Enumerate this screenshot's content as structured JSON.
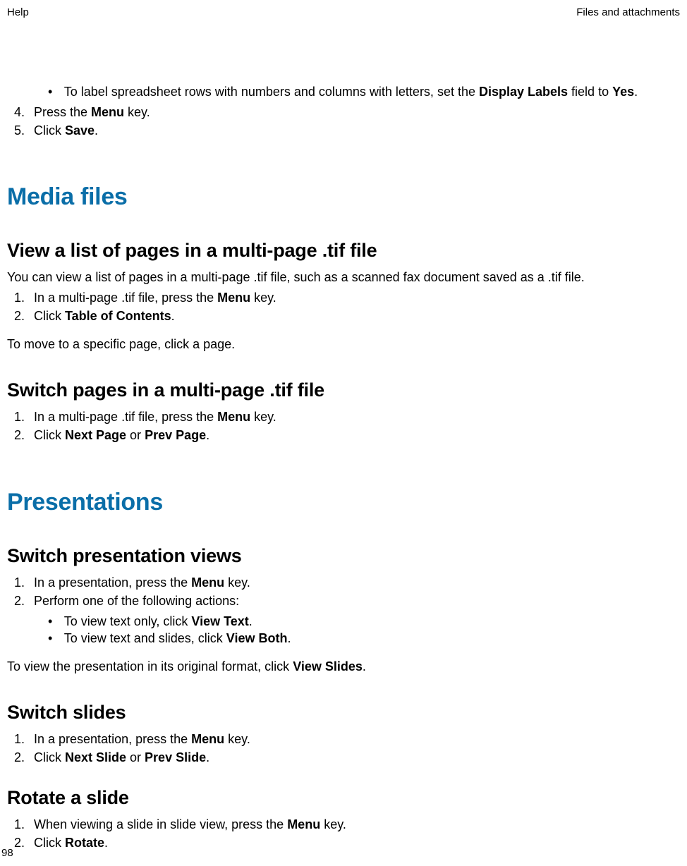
{
  "header": {
    "left": "Help",
    "right": "Files and attachments"
  },
  "top": {
    "bullet": {
      "pre": "To label spreadsheet rows with numbers and columns with letters, set the ",
      "b1": "Display Labels",
      "mid": " field to ",
      "b2": "Yes",
      "post": "."
    },
    "step4": {
      "num": "4.",
      "pre": "Press the ",
      "b": "Menu",
      "post": " key."
    },
    "step5": {
      "num": "5.",
      "pre": "Click ",
      "b": "Save",
      "post": "."
    }
  },
  "media": {
    "heading": "Media files",
    "viewList": {
      "heading": "View a list of pages in a multi-page .tif file",
      "intro": "You can view a list of pages in a multi-page .tif file, such as a scanned fax document saved as a .tif file.",
      "step1": {
        "num": "1.",
        "pre": "In a multi-page .tif file, press the ",
        "b": "Menu",
        "post": " key."
      },
      "step2": {
        "num": "2.",
        "pre": "Click ",
        "b": "Table of Contents",
        "post": "."
      },
      "follow": "To move to a specific page, click a page."
    },
    "switchPages": {
      "heading": "Switch pages in a multi-page .tif file",
      "step1": {
        "num": "1.",
        "pre": "In a multi-page .tif file, press the ",
        "b": "Menu",
        "post": " key."
      },
      "step2": {
        "num": "2.",
        "pre": "Click ",
        "b1": "Next Page",
        "mid": " or ",
        "b2": "Prev Page",
        "post": "."
      }
    }
  },
  "presentations": {
    "heading": "Presentations",
    "switchViews": {
      "heading": "Switch presentation views",
      "step1": {
        "num": "1.",
        "pre": "In a presentation, press the ",
        "b": "Menu",
        "post": " key."
      },
      "step2": {
        "num": "2.",
        "text": "Perform one of the following actions:"
      },
      "sub1": {
        "pre": "To view text only, click ",
        "b": "View Text",
        "post": "."
      },
      "sub2": {
        "pre": "To view text and slides, click ",
        "b": "View Both",
        "post": "."
      },
      "follow": {
        "pre": "To view the presentation in its original format, click ",
        "b": "View Slides",
        "post": "."
      }
    },
    "switchSlides": {
      "heading": "Switch slides",
      "step1": {
        "num": "1.",
        "pre": "In a presentation, press the ",
        "b": "Menu",
        "post": " key."
      },
      "step2": {
        "num": "2.",
        "pre": "Click ",
        "b1": "Next Slide",
        "mid": " or ",
        "b2": "Prev Slide",
        "post": "."
      }
    },
    "rotate": {
      "heading": "Rotate a slide",
      "step1": {
        "num": "1.",
        "pre": "When viewing a slide in slide view, press the ",
        "b": "Menu",
        "post": " key."
      },
      "step2": {
        "num": "2.",
        "pre": "Click ",
        "b": "Rotate",
        "post": "."
      }
    }
  },
  "pageNumber": "98"
}
